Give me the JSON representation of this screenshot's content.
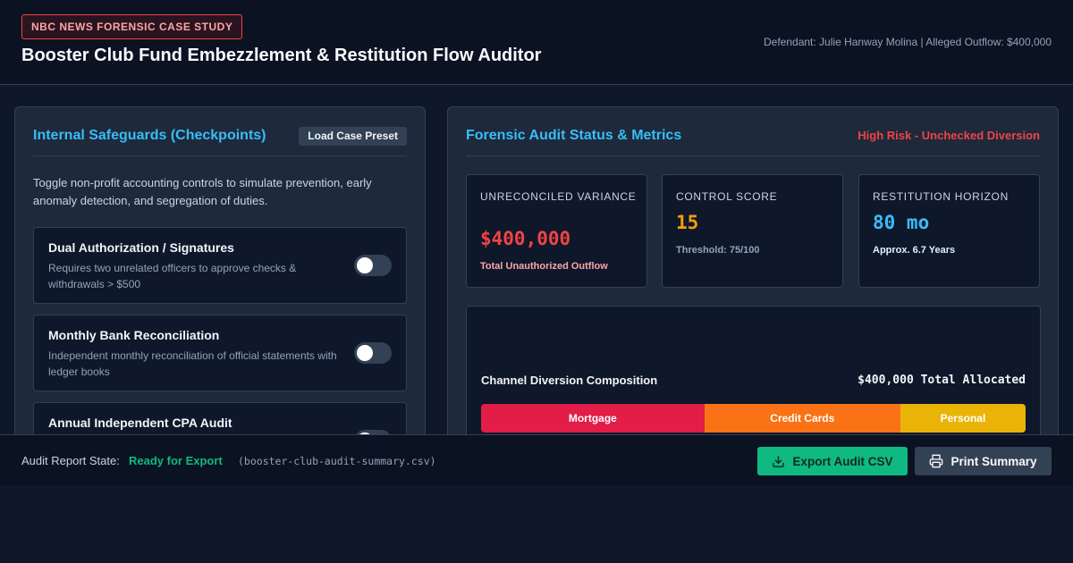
{
  "header": {
    "badge": "NBC NEWS FORENSIC CASE STUDY",
    "title": "Booster Club Fund Embezzlement & Restitution Flow Auditor",
    "defendant_info": "Defendant: Julie Hanway Molina | Alleged Outflow: $400,000"
  },
  "safeguards": {
    "title": "Internal Safeguards (Checkpoints)",
    "preset_button": "Load Case Preset",
    "description": "Toggle non-profit accounting controls to simulate prevention, early anomaly detection, and segregation of duties.",
    "controls": [
      {
        "name": "Dual Authorization / Signatures",
        "desc": "Requires two unrelated officers to approve checks & withdrawals > $500",
        "enabled": false
      },
      {
        "name": "Monthly Bank Reconciliation",
        "desc": "Independent monthly reconciliation of official statements with ledger books",
        "enabled": false
      },
      {
        "name": "Annual Independent CPA Audit",
        "desc": "",
        "enabled": false
      }
    ]
  },
  "audit": {
    "title": "Forensic Audit Status & Metrics",
    "risk_status": "High Risk - Unchecked Diversion",
    "metrics": [
      {
        "label": "UNRECONCILED VARIANCE",
        "value": "$400,000",
        "note": "Total Unauthorized Outflow"
      },
      {
        "label": "CONTROL SCORE",
        "value": "15",
        "note": "Threshold: 75/100"
      },
      {
        "label": "RESTITUTION HORIZON",
        "value": "80 mo",
        "note": "Approx. 6.7 Years"
      }
    ],
    "colors": {
      "danger": "#ef4444",
      "warning": "#f59e0b",
      "info": "#38bdf8"
    },
    "composition": {
      "title": "Channel Diversion Composition",
      "total": "$400,000 Total Allocated",
      "segments": [
        {
          "label": "Mortgage",
          "share": 0.41,
          "color": "#e11d48"
        },
        {
          "label": "Credit Cards",
          "share": 0.36,
          "color": "#f97316"
        },
        {
          "label": "Personal",
          "share": 0.23,
          "color": "#eab308"
        }
      ]
    }
  },
  "footer": {
    "label": "Audit Report State:",
    "state": "Ready for Export",
    "filename": "(booster-club-audit-summary.csv)",
    "export_button": "Export Audit CSV",
    "print_button": "Print Summary",
    "export_icon": "download-icon",
    "print_icon": "printer-icon"
  }
}
